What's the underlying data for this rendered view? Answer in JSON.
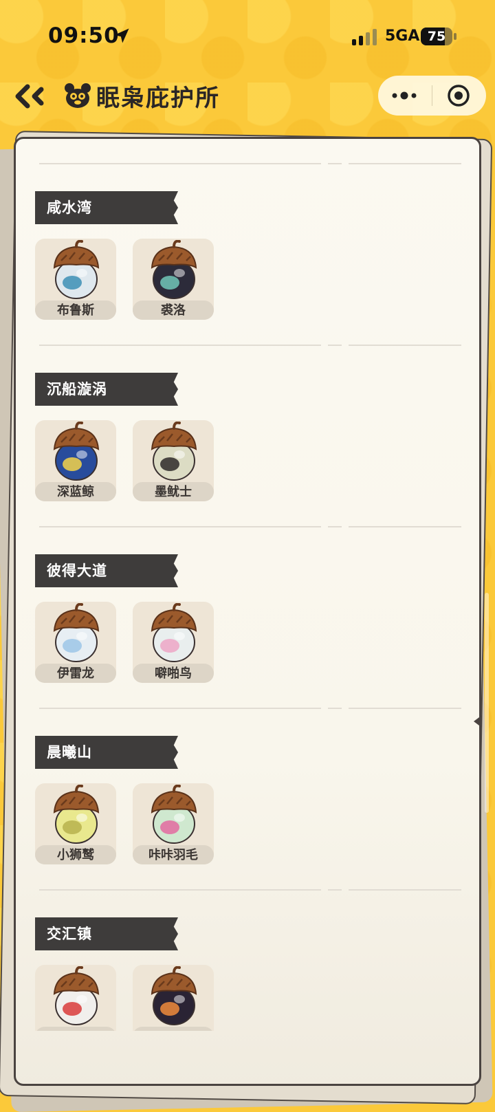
{
  "status_bar": {
    "time": "09:50",
    "network": "5GA",
    "battery": "75",
    "battery_level": 0.75
  },
  "nav": {
    "title": "眠枭庇护所",
    "back_icon": "double-chevron-left-icon",
    "title_icon": "bear-head-icon",
    "more_icon": "more-dots-icon",
    "close_icon": "target-circle-icon"
  },
  "colors": {
    "background": "#fbc93a",
    "paper": "#f9f6ec",
    "header": "#3e3c3b"
  },
  "sections": [
    {
      "name": "咸水湾",
      "items": [
        {
          "label": "布鲁斯",
          "body": "#dfe8ee",
          "accent": "#3d8fb5"
        },
        {
          "label": "裘洛",
          "body": "#2c2b3a",
          "accent": "#71c7b9"
        }
      ]
    },
    {
      "name": "沉船漩涡",
      "items": [
        {
          "label": "深蓝鲸",
          "body": "#284c9c",
          "accent": "#f3d34a"
        },
        {
          "label": "墨鱿士",
          "body": "#dcdcc4",
          "accent": "#2e2a2a"
        }
      ]
    },
    {
      "name": "彼得大道",
      "items": [
        {
          "label": "伊雷龙",
          "body": "#e7eef3",
          "accent": "#9cc6e6"
        },
        {
          "label": "噼啪鸟",
          "body": "#e9eeee",
          "accent": "#eda6c6"
        }
      ]
    },
    {
      "name": "晨曦山",
      "items": [
        {
          "label": "小狮鹫",
          "body": "#e9e88e",
          "accent": "#b7b14e"
        },
        {
          "label": "咔咔羽毛",
          "body": "#cfe8cf",
          "accent": "#e36aa0"
        }
      ]
    },
    {
      "name": "交汇镇",
      "items": [
        {
          "label": "",
          "body": "#f1efec",
          "accent": "#d93b3b"
        },
        {
          "label": "",
          "body": "#2a2334",
          "accent": "#f08b3c"
        }
      ]
    }
  ]
}
